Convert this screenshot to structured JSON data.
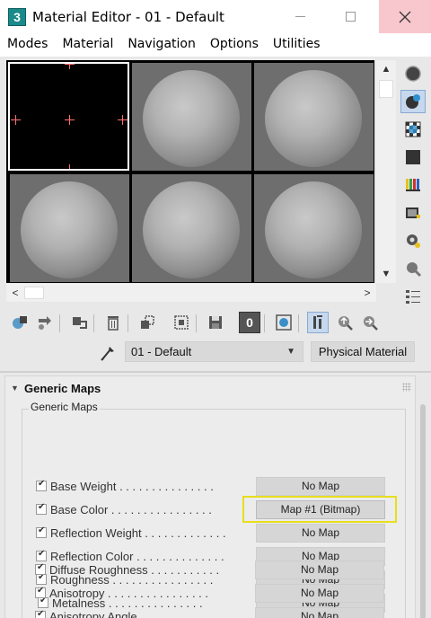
{
  "window": {
    "title": "Material Editor - 01 - Default",
    "app_icon_text": "3"
  },
  "menu": {
    "items": [
      "Modes",
      "Material",
      "Navigation",
      "Options",
      "Utilities"
    ]
  },
  "material": {
    "name": "01 - Default",
    "type_button": "Physical Material"
  },
  "rollout": {
    "title": "Generic Maps",
    "group_label": "Generic Maps",
    "rows": [
      {
        "label": "Base Weight . . . . . . . . . . . . . . .",
        "map": "No Map",
        "checked": true
      },
      {
        "label": "Base Color . . . . . . . . . . . . . . . .",
        "map": "Map #1 (Bitmap)",
        "checked": true
      },
      {
        "label": "Reflection Weight . . . . . . . . . . . . .",
        "map": "No Map",
        "checked": true
      },
      {
        "label": "Reflection Color . . . . . . . . . . . . . .",
        "map": "No Map",
        "checked": true
      },
      {
        "label": "Roughness . . . . . . . . . . . . . . . .",
        "map": "No Map",
        "checked": true
      },
      {
        "label": "Metalness . . . . . . . . . . . . . . .",
        "map": "No Map",
        "checked": true
      },
      {
        "label": "Diffuse Roughness  . . . . . . . . . . .",
        "map": "No Map",
        "checked": true
      },
      {
        "label": "Anisotropy . . . . . . . . . . . . . . . .",
        "map": "No Map",
        "checked": true
      },
      {
        "label": "Anisotropy Angle . . . . . . . . . . . . .",
        "map": "No Map",
        "checked": true
      }
    ]
  },
  "colors": {
    "highlight": "#e8de1c",
    "selected_tool": "#c6d8ee",
    "close_hover": "#f8c7cd"
  },
  "icons": {
    "side_tools": [
      "sample-type-sphere-icon",
      "backlight-icon",
      "background-checker-icon",
      "sample-uv-tiling-icon",
      "video-color-check-icon",
      "make-preview-icon",
      "options-icon",
      "select-by-material-icon",
      "material-map-navigator-icon"
    ],
    "toolbar": [
      "get-material-icon",
      "put-to-scene-icon",
      "assign-to-selection-icon",
      "reset-icon",
      "make-copy-icon",
      "make-unique-icon",
      "put-to-library-icon",
      "material-id-channel-icon",
      "show-shaded-material-icon",
      "show-end-result-icon",
      "go-to-parent-icon",
      "go-forward-to-sibling-icon"
    ]
  },
  "toolbar": {
    "material_id_channel": "0"
  }
}
